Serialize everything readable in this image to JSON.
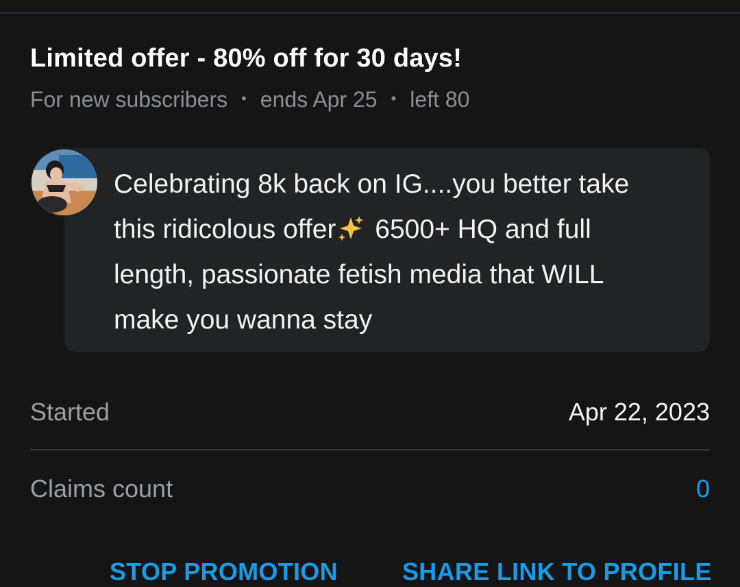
{
  "offer": {
    "title": "Limited offer - 80% off for 30 days!",
    "audience": "For new subscribers",
    "ends": "ends Apr 25",
    "left": "left 80",
    "separator": "•"
  },
  "message": {
    "line1": "Celebrating 8k back on IG....you better take",
    "line2_before_emoji": "this ridicolous offer",
    "emoji": "sparkles-icon",
    "line2_after_emoji": " 6500+ HQ and full",
    "line3": "length, passionate fetish media that WILL",
    "line4": "make you wanna stay"
  },
  "details": {
    "started_label": "Started",
    "started_value": "Apr 22, 2023",
    "claims_label": "Claims count",
    "claims_value": "0"
  },
  "actions": {
    "stop_label": "STOP PROMOTION",
    "share_label": "SHARE LINK TO PROFILE"
  },
  "colors": {
    "background": "#151515",
    "bubble": "#222325",
    "accent": "#1b9ae6",
    "muted_text": "#8a8f96"
  }
}
